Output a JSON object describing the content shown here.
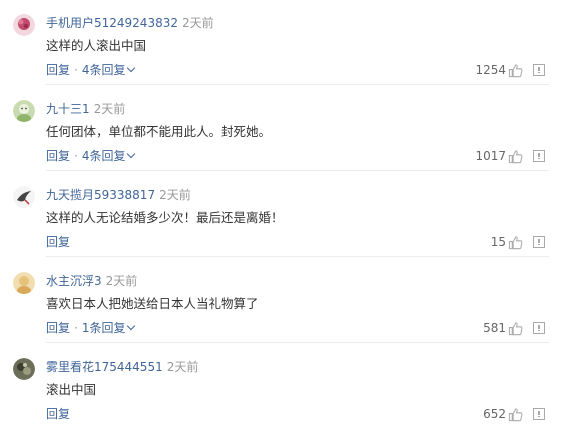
{
  "comments": [
    {
      "user": "手机用户51249243832",
      "time": "2天前",
      "text": "这样的人滚出中国",
      "reply_label": "回复",
      "sep": "·",
      "replies_label": "4条回复",
      "likes": "1254",
      "avatar_icon": "pink-flower-avatar"
    },
    {
      "user": "九十三1",
      "time": "2天前",
      "text": "任何团体，单位都不能用此人。封死她。",
      "reply_label": "回复",
      "sep": "·",
      "replies_label": "4条回复",
      "likes": "1017",
      "avatar_icon": "green-cartoon-avatar"
    },
    {
      "user": "九天揽月59338817",
      "time": "2天前",
      "text": "这样的人无论结婚多少次！最后还是离婚！",
      "reply_label": "回复",
      "likes": "15",
      "avatar_icon": "bird-avatar"
    },
    {
      "user": "水主沉浮3",
      "time": "2天前",
      "text": "喜欢日本人把她送给日本人当礼物算了",
      "reply_label": "回复",
      "sep": "·",
      "replies_label": "1条回复",
      "likes": "581",
      "avatar_icon": "sand-avatar"
    },
    {
      "user": "雾里看花175444551",
      "time": "2天前",
      "text": "滚出中国",
      "reply_label": "回复",
      "likes": "652",
      "avatar_icon": "dark-photo-avatar"
    }
  ],
  "colors": {
    "username": "#406599",
    "muted": "#999999",
    "divider": "#ececec"
  }
}
